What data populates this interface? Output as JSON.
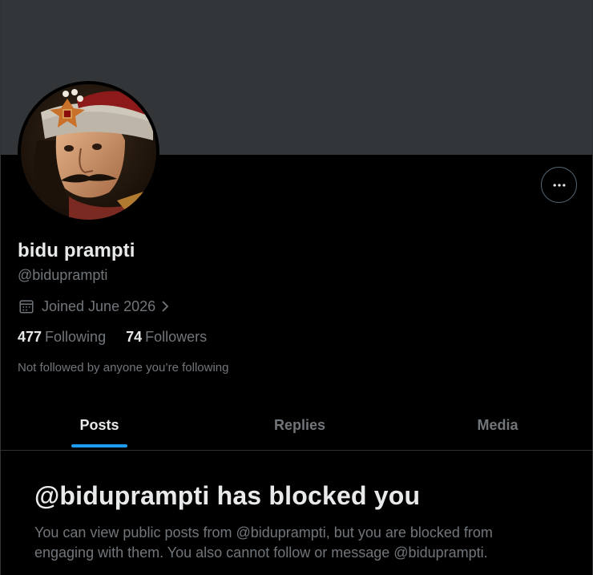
{
  "profile": {
    "name": "bidu prampti",
    "handle": "@biduprampti",
    "joined": "Joined June 2026",
    "following_count": "477",
    "following_label": "Following",
    "followers_count": "74",
    "followers_label": "Followers",
    "not_followed_text": "Not followed by anyone you’re following"
  },
  "tabs": [
    {
      "label": "Posts",
      "active": true
    },
    {
      "label": "Replies",
      "active": false
    },
    {
      "label": "Media",
      "active": false
    }
  ],
  "blocked": {
    "title": "@biduprampti has blocked you",
    "description": "You can view public posts from @biduprampti, but you are blocked from engaging with them. You also cannot follow or message @biduprampti."
  },
  "icons": {
    "more": "more-horizontal-icon",
    "calendar": "calendar-icon",
    "chevron": "chevron-right-icon"
  },
  "colors": {
    "background": "#000000",
    "banner": "#333639",
    "text_primary": "#e7e9ea",
    "text_secondary": "#71767b",
    "accent": "#1d9bf0",
    "divider": "#2f3336"
  }
}
